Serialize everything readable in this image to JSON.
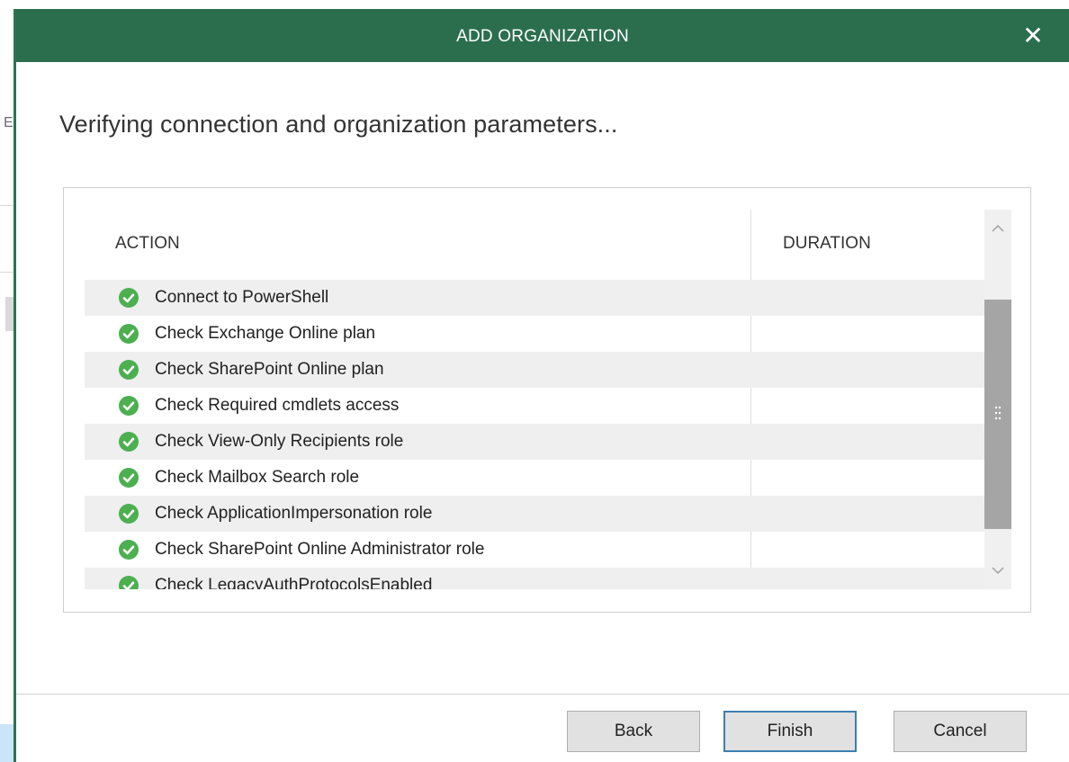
{
  "background": {
    "partial_letter": "E"
  },
  "dialog": {
    "title": "ADD ORGANIZATION",
    "close_glyph": "✕",
    "heading": "Verifying connection and organization parameters...",
    "colors": {
      "titlebar": "#2b6e4e",
      "success": "#4caf50"
    }
  },
  "table": {
    "columns": [
      "ACTION",
      "DURATION"
    ],
    "rows": [
      {
        "action": "Connect to PowerShell",
        "status_icon": "check-circle-icon",
        "duration": ""
      },
      {
        "action": "Check Exchange Online plan",
        "status_icon": "check-circle-icon",
        "duration": ""
      },
      {
        "action": "Check SharePoint Online plan",
        "status_icon": "check-circle-icon",
        "duration": ""
      },
      {
        "action": "Check Required cmdlets access",
        "status_icon": "check-circle-icon",
        "duration": ""
      },
      {
        "action": "Check View-Only Recipients role",
        "status_icon": "check-circle-icon",
        "duration": ""
      },
      {
        "action": "Check Mailbox Search role",
        "status_icon": "check-circle-icon",
        "duration": ""
      },
      {
        "action": "Check ApplicationImpersonation role",
        "status_icon": "check-circle-icon",
        "duration": ""
      },
      {
        "action": "Check SharePoint Online Administrator role",
        "status_icon": "check-circle-icon",
        "duration": ""
      },
      {
        "action": "Check LegacyAuthProtocolsEnabled",
        "status_icon": "check-circle-icon",
        "duration": ""
      }
    ]
  },
  "buttons": {
    "back": "Back",
    "finish": "Finish",
    "cancel": "Cancel"
  }
}
